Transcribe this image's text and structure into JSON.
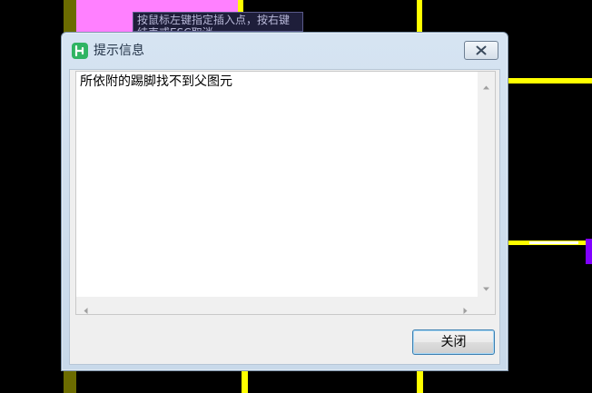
{
  "background": {
    "tooltip_text": "按鼠标左键指定插入点，按右键结束或ESC取消"
  },
  "dialog": {
    "title": "提示信息",
    "message": "所依附的踢脚找不到父图元",
    "close_button_label": "关闭"
  },
  "icons": {
    "app": "app-icon",
    "title_close": "close-icon",
    "scroll_up": "arrow-up-icon",
    "scroll_down": "arrow-down-icon",
    "scroll_left": "arrow-left-icon",
    "scroll_right": "arrow-right-icon"
  },
  "colors": {
    "cad_background": "#000000",
    "cad_yellow": "#ffff00",
    "cad_pink": "#ff80ff",
    "cad_purple": "#8000ff",
    "cad_olive": "#6b6b00",
    "app_icon_green": "#2fb463",
    "button_focus_border": "#3c7fb1"
  }
}
